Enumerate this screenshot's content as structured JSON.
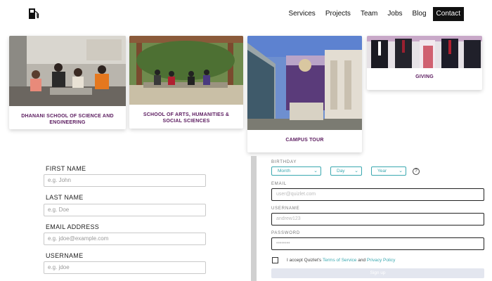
{
  "nav": {
    "items": [
      "Services",
      "Projects",
      "Team",
      "Jobs",
      "Blog"
    ],
    "contact": "Contact"
  },
  "cards": [
    {
      "caption": "DHANANI SCHOOL OF SCIENCE AND ENGINEERING"
    },
    {
      "caption": "SCHOOL OF ARTS, HUMANITIES & SOCIAL SCIENCES"
    },
    {
      "caption": "CAMPUS TOUR"
    },
    {
      "caption": "GIVING"
    }
  ],
  "left_form": {
    "first_name_label": "FIRST NAME",
    "first_name_placeholder": "e.g. John",
    "last_name_label": "LAST NAME",
    "last_name_placeholder": "e.g. Doe",
    "email_label": "EMAIL ADDRESS",
    "email_placeholder": "e.g. jdoe@example.com",
    "username_label": "USERNAME",
    "username_placeholder": "e.g. jdoe"
  },
  "right_form": {
    "birthday_label": "BIRTHDAY",
    "month": "Month",
    "day": "Day",
    "year": "Year",
    "help": "?",
    "email_label": "EMAIL",
    "email_placeholder": "user@quizlet.com",
    "username_label": "USERNAME",
    "username_placeholder": "andrew123",
    "password_label": "PASSWORD",
    "password_placeholder": "••••••••",
    "terms_prefix": "I accept Quizlet's",
    "terms_link": "Terms of Service",
    "terms_and": "and",
    "privacy_link": "Privacy Policy",
    "signup": "Sign up"
  },
  "colors": {
    "caption": "#5a1a5e",
    "accent": "#3aa8b0",
    "signup_bg": "#e3e6ef"
  }
}
